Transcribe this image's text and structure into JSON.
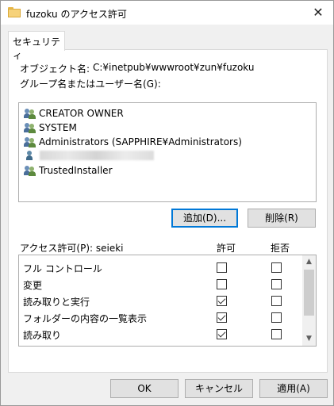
{
  "window": {
    "title": "fuzoku のアクセス許可",
    "close_glyph": "✕"
  },
  "tabs": [
    {
      "label": "セキュリティ"
    }
  ],
  "object": {
    "label": "オブジェクト名:",
    "value": "C:¥inetpub¥wwwroot¥zun¥fuzoku"
  },
  "group_label": "グループ名またはユーザー名(G):",
  "users": [
    {
      "name": "CREATOR OWNER",
      "icon": "users-icon"
    },
    {
      "name": "SYSTEM",
      "icon": "users-icon"
    },
    {
      "name": "Administrators (SAPPHIRE¥Administrators)",
      "icon": "users-icon"
    },
    {
      "name": "",
      "icon": "user-icon",
      "redacted": true
    },
    {
      "name": "TrustedInstaller",
      "icon": "users-icon"
    }
  ],
  "buttons": {
    "add": "追加(D)...",
    "remove": "削除(R)",
    "ok": "OK",
    "cancel": "キャンセル",
    "apply": "適用(A)"
  },
  "permissions": {
    "label": "アクセス許可(P): seieki",
    "allow_header": "許可",
    "deny_header": "拒否",
    "rows": [
      {
        "name": "フル コントロール",
        "allow": false,
        "deny": false
      },
      {
        "name": "変更",
        "allow": false,
        "deny": false
      },
      {
        "name": "読み取りと実行",
        "allow": true,
        "deny": false
      },
      {
        "name": "フォルダーの内容の一覧表示",
        "allow": true,
        "deny": false
      },
      {
        "name": "読み取り",
        "allow": true,
        "deny": false
      }
    ]
  },
  "scroll": {
    "up": "▲",
    "down": "▼"
  }
}
